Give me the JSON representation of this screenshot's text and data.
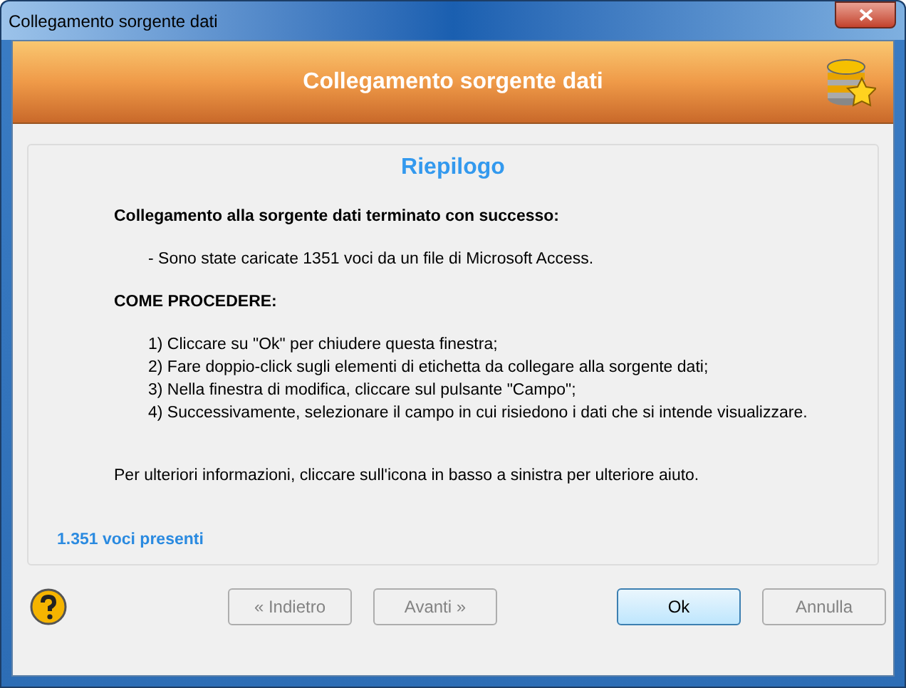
{
  "window": {
    "title": "Collegamento sorgente dati"
  },
  "header": {
    "title": "Collegamento sorgente dati"
  },
  "summary": {
    "title": "Riepilogo",
    "blocks": [
      {
        "kind": "heading",
        "lines": [
          "Collegamento alla sorgente dati terminato con successo:"
        ]
      },
      {
        "kind": "list",
        "lines": [
          "- Sono state caricate 1351 voci da un file di Microsoft Access."
        ]
      },
      {
        "kind": "heading",
        "lines": [
          "COME PROCEDERE:"
        ]
      },
      {
        "kind": "list",
        "lines": [
          "1) Cliccare su \"Ok\" per chiudere questa finestra;",
          "2) Fare doppio-click sugli elementi di etichetta da collegare alla sorgente dati;",
          "3) Nella finestra di modifica, cliccare sul pulsante \"Campo\";",
          "4) Successivamente, selezionare il campo in cui risiedono i dati che si intende visualizzare."
        ]
      },
      {
        "kind": "note",
        "lines": [
          "Per ulteriori informazioni, cliccare sull'icona in basso a sinistra per ulteriore aiuto."
        ]
      }
    ],
    "count": "1.351 voci presenti"
  },
  "buttons": [
    {
      "label": "« Indietro",
      "disabled": true,
      "default": false
    },
    {
      "label": "Avanti »",
      "disabled": true,
      "default": false
    },
    {
      "label": "Ok",
      "disabled": false,
      "default": true
    },
    {
      "label": "Annulla",
      "disabled": true,
      "default": false
    }
  ]
}
